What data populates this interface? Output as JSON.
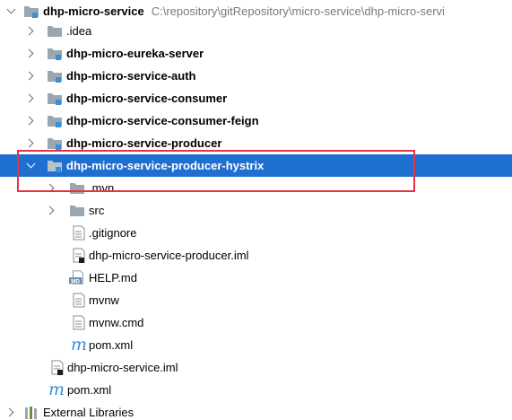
{
  "root": {
    "name": "dhp-micro-service",
    "path": "C:\\repository\\gitRepository\\micro-service\\dhp-micro-servi"
  },
  "children": {
    "idea": ".idea",
    "eureka": "dhp-micro-eureka-server",
    "auth": "dhp-micro-service-auth",
    "consumer": "dhp-micro-service-consumer",
    "consumer_feign": "dhp-micro-service-consumer-feign",
    "producer": "dhp-micro-service-producer",
    "producer_hystrix": "dhp-micro-service-producer-hystrix",
    "mvn": ".mvn",
    "src": "src",
    "gitignore": ".gitignore",
    "producer_iml": "dhp-micro-service-producer.iml",
    "help_md": "HELP.md",
    "mvnw": "mvnw",
    "mvnw_cmd": "mvnw.cmd",
    "pom_inner": "pom.xml",
    "service_iml": "dhp-micro-service.iml",
    "pom_root": "pom.xml",
    "external_libraries": "External Libraries"
  },
  "icons": {
    "md_badge": "MD",
    "maven_letter": "m"
  },
  "colors": {
    "selection": "#1f6fd1",
    "highlight_border": "#e53344",
    "module_square": "#3a8fd8",
    "folder": "#9aa7b0"
  }
}
